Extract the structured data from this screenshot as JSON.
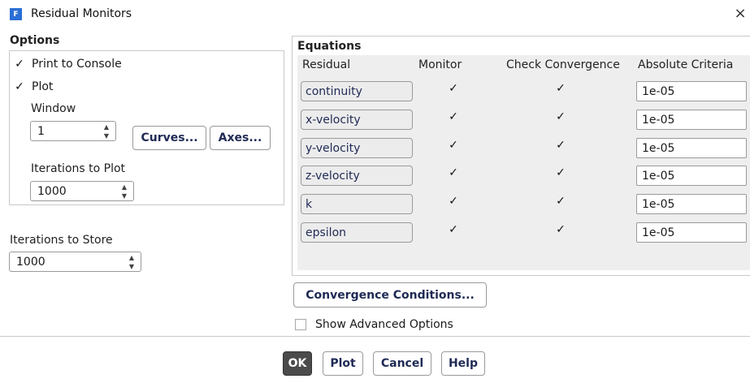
{
  "window": {
    "title": "Residual Monitors",
    "app_icon": "F",
    "close_glyph": "×"
  },
  "options": {
    "title": "Options",
    "print_to_console": {
      "label": "Print to Console",
      "checked": true
    },
    "plot": {
      "label": "Plot",
      "checked": true
    },
    "window_label": "Window",
    "window_value": "1",
    "curves_button": "Curves...",
    "axes_button": "Axes...",
    "iterations_to_plot_label": "Iterations to Plot",
    "iterations_to_plot_value": "1000"
  },
  "store": {
    "label": "Iterations to Store",
    "value": "1000"
  },
  "equations": {
    "title": "Equations",
    "headers": {
      "residual": "Residual",
      "monitor": "Monitor",
      "check": "Check Convergence",
      "criteria": "Absolute Criteria"
    },
    "rows": [
      {
        "residual": "continuity",
        "monitor": true,
        "check": true,
        "criteria": "1e-05"
      },
      {
        "residual": "x-velocity",
        "monitor": true,
        "check": true,
        "criteria": "1e-05"
      },
      {
        "residual": "y-velocity",
        "monitor": true,
        "check": true,
        "criteria": "1e-05"
      },
      {
        "residual": "z-velocity",
        "monitor": true,
        "check": true,
        "criteria": "1e-05"
      },
      {
        "residual": "k",
        "monitor": true,
        "check": true,
        "criteria": "1e-05"
      },
      {
        "residual": "epsilon",
        "monitor": true,
        "check": true,
        "criteria": "1e-05"
      }
    ]
  },
  "convergence_button": "Convergence Conditions...",
  "show_advanced": {
    "label": "Show Advanced Options",
    "checked": false
  },
  "footer": {
    "ok": "OK",
    "plot": "Plot",
    "cancel": "Cancel",
    "help": "Help"
  },
  "check_glyph": "✓",
  "spin_up": "▲",
  "spin_down": "▼"
}
